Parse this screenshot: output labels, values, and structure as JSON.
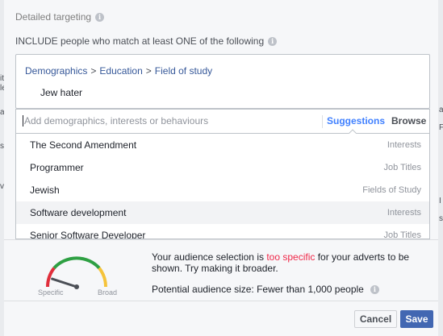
{
  "background_fragments": [
    "it",
    "le",
    "a",
    "ss",
    "v",
    "ag",
    "Fe",
    "I",
    "s"
  ],
  "section": {
    "title": "Detailed targeting",
    "info_icon": "info-icon"
  },
  "include_label": "INCLUDE people who match at least ONE of the following",
  "selected": {
    "breadcrumb": [
      "Demographics",
      "Education",
      "Field of study"
    ],
    "separator": ">",
    "item": "Jew hater"
  },
  "search": {
    "placeholder": "Add demographics, interests or behaviours",
    "value": "",
    "tabs": {
      "suggestions": "Suggestions",
      "browse": "Browse"
    }
  },
  "suggestions": [
    {
      "name": "The Second Amendment",
      "type": "Interests"
    },
    {
      "name": "Programmer",
      "type": "Job Titles"
    },
    {
      "name": "Jewish",
      "type": "Fields of Study"
    },
    {
      "name": "Software development",
      "type": "Interests",
      "highlighted": true
    },
    {
      "name": "Senior Software Developer",
      "type": "Job Titles"
    }
  ],
  "gauge": {
    "left_label": "Specific",
    "right_label": "Broad",
    "level": 0.1
  },
  "message": {
    "before": "Your audience selection is ",
    "highlight": "too specific",
    "after": " for your adverts to be shown. Try making it broader."
  },
  "audience_size": "Potential audience size: Fewer than 1,000 people",
  "buttons": {
    "cancel": "Cancel",
    "save": "Save"
  },
  "colors": {
    "link": "#365899",
    "accent": "#4080ff",
    "warning": "#f02849",
    "primary_button": "#4267b2"
  }
}
